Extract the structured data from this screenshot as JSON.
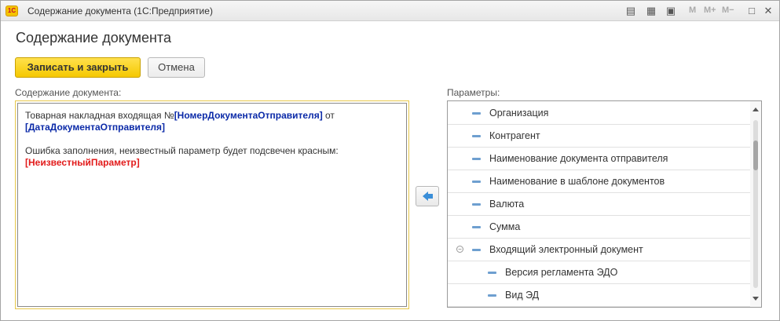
{
  "window": {
    "logo_text": "1С",
    "title": "Содержание документа  (1С:Предприятие)",
    "toolbar_m": "M",
    "toolbar_mplus": "M+",
    "toolbar_mminus": "M−"
  },
  "form": {
    "title": "Содержание документа",
    "save_close_label": "Записать и закрыть",
    "cancel_label": "Отмена"
  },
  "editor": {
    "label": "Содержание документа:",
    "line1_text": "Товарная накладная входящая №",
    "line1_param": "[НомерДокументаОтправителя]",
    "line1_suffix": " от",
    "line2_param": "[ДатаДокументаОтправителя]",
    "line3_text": "Ошибка заполнения, неизвестный параметр будет подсвечен красным:",
    "line4_param": "[НеизвестныйПараметр]"
  },
  "parameters": {
    "label": "Параметры:",
    "items": [
      {
        "label": "Организация",
        "level": 0
      },
      {
        "label": "Контрагент",
        "level": 0
      },
      {
        "label": "Наименование документа отправителя",
        "level": 0
      },
      {
        "label": "Наименование в шаблоне документов",
        "level": 0
      },
      {
        "label": "Валюта",
        "level": 0
      },
      {
        "label": "Сумма",
        "level": 0
      },
      {
        "label": "Входящий электронный документ",
        "level": 0,
        "expanded": true
      },
      {
        "label": "Версия регламента ЭДО",
        "level": 1
      },
      {
        "label": "Вид ЭД",
        "level": 1
      }
    ],
    "scroll_position": 0.15
  },
  "colors": {
    "accent_yellow": "#f5c800",
    "param_known": "#0b2aa8",
    "param_unknown": "#e21b1b"
  }
}
